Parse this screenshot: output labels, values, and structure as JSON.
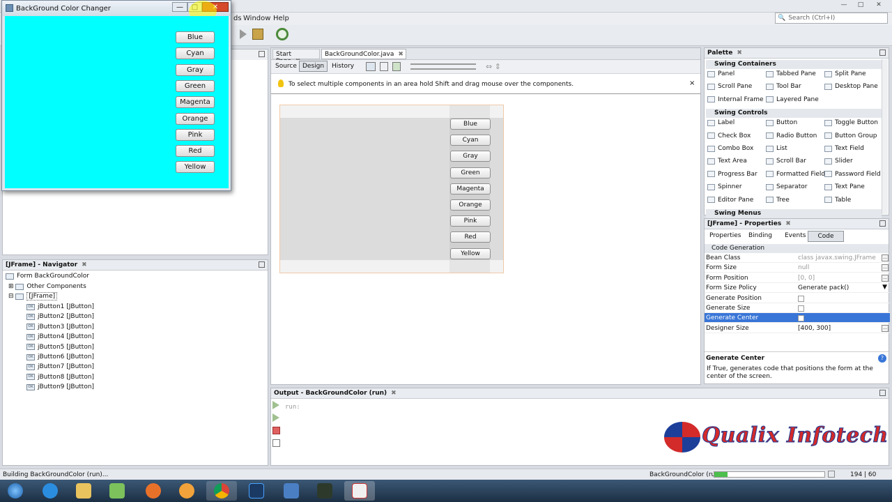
{
  "app_window": {
    "title": "BackGround Color Changer",
    "buttons": [
      "Blue",
      "Cyan",
      "Gray",
      "Green",
      "Magenta",
      "Orange",
      "Pink",
      "Red",
      "Yellow"
    ],
    "background_color": "#00ffff"
  },
  "menu": {
    "partial": "ds",
    "window": "Window",
    "help": "Help"
  },
  "search": {
    "placeholder": "Search (Ctrl+I)"
  },
  "editor": {
    "tabs": [
      "Start Page",
      "BackGroundColor.java"
    ],
    "view_tabs": [
      "Source",
      "Design",
      "History"
    ],
    "hint": "To select multiple components in an area hold Shift and drag mouse over the components.",
    "close": "×",
    "design_buttons": [
      "Blue",
      "Cyan",
      "Gray",
      "Green",
      "Magenta",
      "Orange",
      "Pink",
      "Red",
      "Yellow"
    ]
  },
  "navigator": {
    "title": "[JFrame] - Navigator",
    "root": "Form BackGroundColor",
    "other": "Other Components",
    "frame": "[JFrame]",
    "items": [
      "jButton1 [JButton]",
      "jButton2 [JButton]",
      "jButton3 [JButton]",
      "jButton4 [JButton]",
      "jButton5 [JButton]",
      "jButton6 [JButton]",
      "jButton7 [JButton]",
      "jButton8 [JButton]",
      "jButton9 [JButton]"
    ]
  },
  "palette": {
    "title": "Palette",
    "sections": [
      {
        "name": "Swing Containers",
        "items": [
          "Panel",
          "Tabbed Pane",
          "Split Pane",
          "Scroll Pane",
          "Tool Bar",
          "Desktop Pane",
          "Internal Frame",
          "Layered Pane"
        ]
      },
      {
        "name": "Swing Controls",
        "items": [
          "Label",
          "Button",
          "Toggle Button",
          "Check Box",
          "Radio Button",
          "Button Group",
          "Combo Box",
          "List",
          "Text Field",
          "Text Area",
          "Scroll Bar",
          "Slider",
          "Progress Bar",
          "Formatted Field",
          "Password Field",
          "Spinner",
          "Separator",
          "Text Pane",
          "Editor Pane",
          "Tree",
          "Table"
        ]
      },
      {
        "name": "Swing Menus",
        "items": []
      }
    ]
  },
  "properties": {
    "title": "[JFrame] - Properties",
    "tabs": [
      "Properties",
      "Binding",
      "Events",
      "Code"
    ],
    "section": "Code Generation",
    "rows": [
      {
        "key": "Bean Class",
        "value": "class javax.swing.JFrame"
      },
      {
        "key": "Form Size",
        "value": "null"
      },
      {
        "key": "Form Position",
        "value": "[0, 0]"
      },
      {
        "key": "Form Size Policy",
        "value": "Generate pack()"
      },
      {
        "key": "Generate Position",
        "value": ""
      },
      {
        "key": "Generate Size",
        "value": ""
      },
      {
        "key": "Generate Center",
        "value": ""
      },
      {
        "key": "Designer Size",
        "value": "[400, 300]"
      }
    ],
    "help_title": "Generate Center",
    "help_text": "If True, generates code that positions the form at the center of the screen."
  },
  "output": {
    "title": "Output - BackGroundColor (run)",
    "text": "run:"
  },
  "watermark": "Qualix Infotech",
  "status": {
    "left": "Building BackGroundColor (run)...",
    "task": "BackGroundColor (run)",
    "position": "194 | 60",
    "progress": 0.12
  },
  "colors": {
    "accent": "#3875d7",
    "brand_red": "#d32a2a",
    "brand_blue": "#1d3f9a"
  }
}
